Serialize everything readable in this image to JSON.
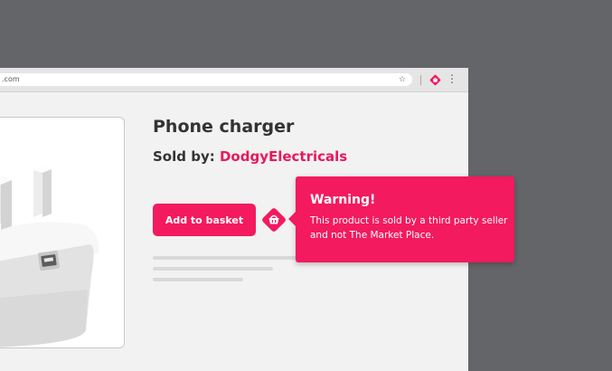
{
  "browser": {
    "url": ".com",
    "icons": [
      "star-icon",
      "extension-basket-icon",
      "more-vert-icon"
    ]
  },
  "product": {
    "title": "Phone charger",
    "sold_by_label": "Sold by:",
    "seller_name": "DodgyElectricals",
    "image": "phone-charger-plug-image",
    "add_button_label": "Add to basket"
  },
  "warning": {
    "title": "Warning!",
    "message": "This product is sold by a third party seller and not The Market Place."
  },
  "colors": {
    "accent": "#f31a5f",
    "seller_text": "#e8195b",
    "background": "#646568",
    "page": "#f2f2f2"
  }
}
